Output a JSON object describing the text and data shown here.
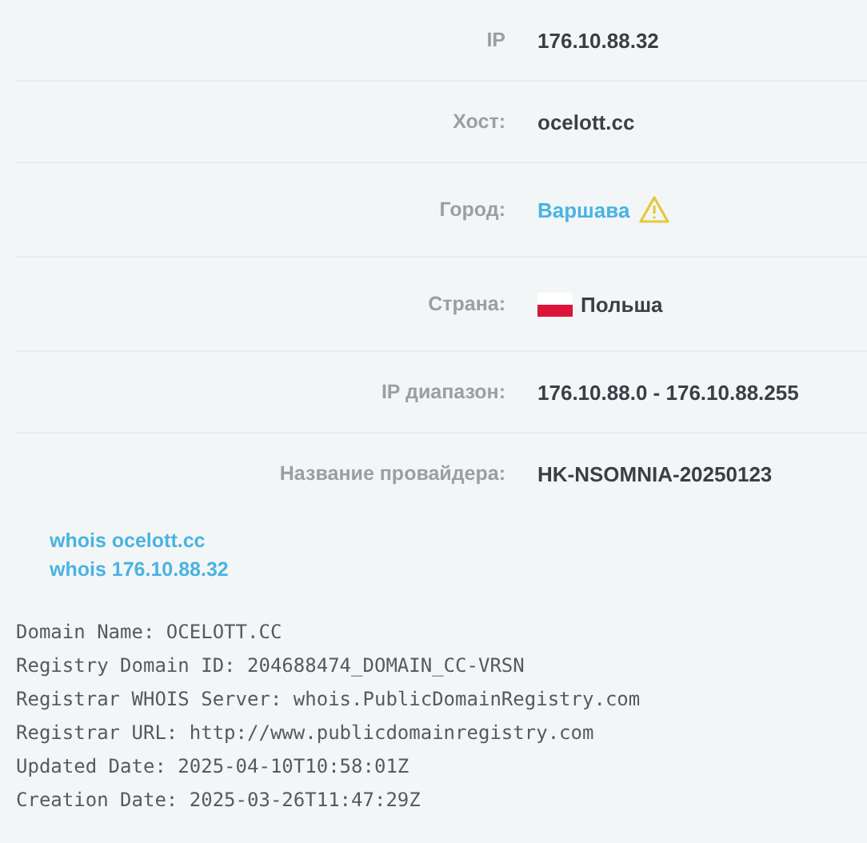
{
  "info_rows": [
    {
      "label": "IP",
      "value": "176.10.88.32",
      "kind": "text"
    },
    {
      "label": "Хост:",
      "value": "ocelott.cc",
      "kind": "text"
    },
    {
      "label": "Город:",
      "value": "Варшава",
      "kind": "warning-link"
    },
    {
      "label": "Страна:",
      "value": "Польша",
      "kind": "flag"
    },
    {
      "label": "IP диапазон:",
      "value": "176.10.88.0 - 176.10.88.255",
      "kind": "text"
    },
    {
      "label": "Название провайдера:",
      "value": "HK-NSOMNIA-20250123",
      "kind": "text"
    }
  ],
  "whois_links": [
    "whois ocelott.cc",
    "whois 176.10.88.32"
  ],
  "whois_lines": [
    "Domain Name: OCELOTT.CC",
    "Registry Domain ID: 204688474_DOMAIN_CC-VRSN",
    "Registrar WHOIS Server: whois.PublicDomainRegistry.com",
    "Registrar URL: http://www.publicdomainregistry.com",
    "Updated Date: 2025-04-10T10:58:01Z",
    "Creation Date: 2025-03-26T11:47:29Z"
  ]
}
